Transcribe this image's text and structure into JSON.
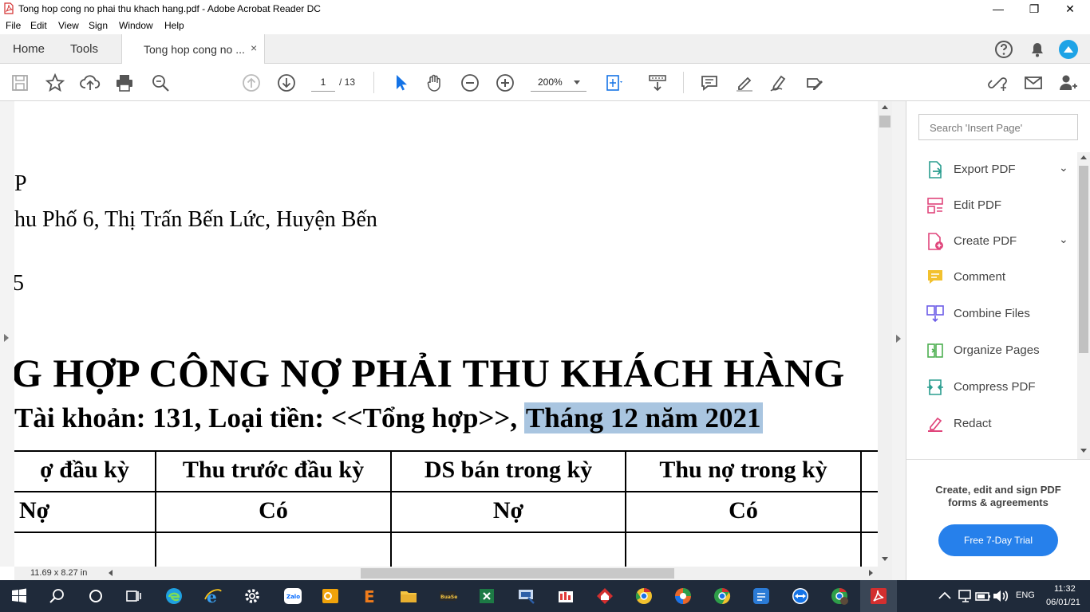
{
  "window": {
    "title": "Tong hop cong no phai thu khach hang.pdf - Adobe Acrobat Reader DC",
    "minimize": "—",
    "maximize": "❐",
    "close": "✕"
  },
  "menu": [
    "File",
    "Edit",
    "View",
    "Sign",
    "Window",
    "Help"
  ],
  "tabs": {
    "home": "Home",
    "tools": "Tools",
    "document": "Tong hop cong no ...",
    "close": "×"
  },
  "toolbar": {
    "page_current": "1",
    "page_total": "/ 13",
    "zoom": "200%"
  },
  "document": {
    "line1": "P",
    "line2": "hu Phố 6, Thị Trấn Bến Lức, Huyện Bến",
    "line3": "5",
    "heading": "G HỢP CÔNG NỢ PHẢI THU KHÁCH HÀNG",
    "subheading_plain": "Tài khoản: 131, Loại tiền: <<Tổng hợp>>, ",
    "subheading_highlight": "Tháng 12 năm 2021",
    "table_headers": [
      "ợ đầu kỳ",
      "Thu trước đầu kỳ",
      "DS bán trong kỳ",
      "Thu nợ trong kỳ"
    ],
    "table_subheaders": [
      "Nợ",
      "Có",
      "Nợ",
      "Có"
    ],
    "page_size": "11.69 x 8.27 in"
  },
  "right_pane": {
    "search_placeholder": "Search 'Insert Page'",
    "tools": [
      {
        "label": "Export PDF",
        "icon": "export-pdf-icon",
        "color": "#2a9d8f"
      },
      {
        "label": "Edit PDF",
        "icon": "edit-pdf-icon",
        "color": "#e0457b"
      },
      {
        "label": "Create PDF",
        "icon": "create-pdf-icon",
        "color": "#e0457b"
      },
      {
        "label": "Comment",
        "icon": "comment-icon",
        "color": "#f2c12e"
      },
      {
        "label": "Combine Files",
        "icon": "combine-files-icon",
        "color": "#6c5ce7"
      },
      {
        "label": "Organize Pages",
        "icon": "organize-pages-icon",
        "color": "#4caf50"
      },
      {
        "label": "Compress PDF",
        "icon": "compress-pdf-icon",
        "color": "#2a9d8f"
      },
      {
        "label": "Redact",
        "icon": "redact-icon",
        "color": "#e0457b"
      }
    ],
    "promo_line1": "Create, edit and sign PDF",
    "promo_line2": "forms & agreements",
    "trial_button": "Free 7-Day Trial"
  },
  "taskbar": {
    "language": "ENG",
    "time": "11:32",
    "date": "06/01/21"
  },
  "colors": {
    "accent": "#2680eb",
    "highlight": "#a9c5e0",
    "taskbar": "#1f2a3a"
  }
}
